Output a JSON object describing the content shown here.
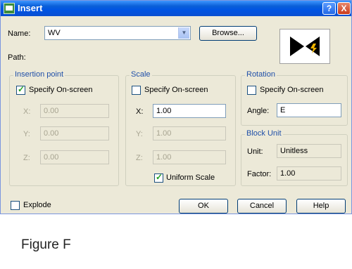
{
  "window": {
    "title": "Insert",
    "help_glyph": "?",
    "close_glyph": "X"
  },
  "name_row": {
    "label": "Name:",
    "value": "WV",
    "browse_label": "Browse..."
  },
  "path_label": "Path:",
  "insertion": {
    "legend": "Insertion point",
    "specify_label": "Specify On-screen",
    "specify_checked": true,
    "x_label": "X:",
    "x_value": "0.00",
    "y_label": "Y:",
    "y_value": "0.00",
    "z_label": "Z:",
    "z_value": "0.00"
  },
  "scale": {
    "legend": "Scale",
    "specify_label": "Specify On-screen",
    "specify_checked": false,
    "x_label": "X:",
    "x_value": "1.00",
    "y_label": "Y:",
    "y_value": "1.00",
    "z_label": "Z:",
    "z_value": "1.00",
    "uniform_label": "Uniform Scale",
    "uniform_checked": true
  },
  "rotation": {
    "legend": "Rotation",
    "specify_label": "Specify On-screen",
    "specify_checked": false,
    "angle_label": "Angle:",
    "angle_value": "E"
  },
  "block_unit": {
    "legend": "Block Unit",
    "unit_label": "Unit:",
    "unit_value": "Unitless",
    "factor_label": "Factor:",
    "factor_value": "1.00"
  },
  "explode": {
    "label": "Explode",
    "checked": false
  },
  "buttons": {
    "ok": "OK",
    "cancel": "Cancel",
    "help": "Help"
  },
  "caption": "Figure F",
  "colors": {
    "titlebar": "#0054e3",
    "dialog_bg": "#ece9d8",
    "group_label": "#1f4fa8"
  }
}
